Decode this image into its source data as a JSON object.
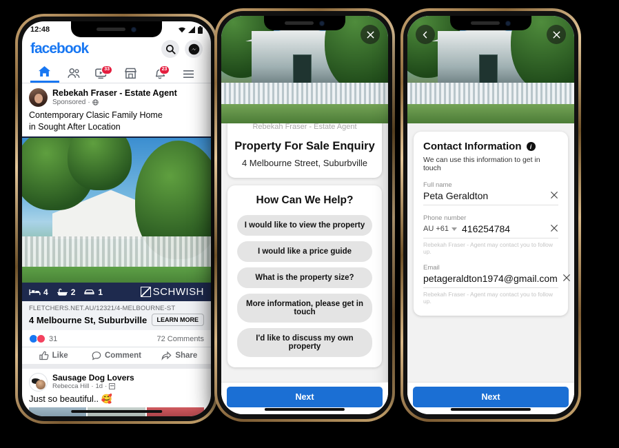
{
  "phone1": {
    "statusbar": {
      "time": "12:48",
      "wifi_icon": "wifi-icon",
      "signal_icon": "signal-icon",
      "battery_icon": "battery-icon"
    },
    "header": {
      "logo": "facebook",
      "search_icon": "search-icon",
      "messenger_icon": "messenger-icon"
    },
    "nav": [
      {
        "name": "home",
        "icon": "home-icon",
        "badge": "",
        "active": true
      },
      {
        "name": "friends",
        "icon": "friends-icon",
        "badge": "",
        "active": false
      },
      {
        "name": "watch",
        "icon": "watch-video-icon",
        "badge": "33",
        "active": false
      },
      {
        "name": "marketplace",
        "icon": "marketplace-icon",
        "badge": "",
        "active": false
      },
      {
        "name": "notifications",
        "icon": "bell-icon",
        "badge": "23",
        "active": false
      },
      {
        "name": "menu",
        "icon": "hamburger-menu-icon",
        "badge": "",
        "active": false
      }
    ],
    "post": {
      "author": "Rebekah Fraser - Estate Agent",
      "sponsored": "Sponsored",
      "globe_icon": "globe-icon",
      "body_line1": "Contemporary Clasic Family Home",
      "body_line2": "in Sought After Location",
      "features": [
        {
          "icon": "bed-icon",
          "value": "4"
        },
        {
          "icon": "bath-icon",
          "value": "2"
        },
        {
          "icon": "car-icon",
          "value": "1"
        }
      ],
      "brand": "SCHWISH",
      "link_url": "FLETCHERS.NET.AU/12321/4-MELBOURNE-ST",
      "link_title": "4 Melbourne St, Suburbville",
      "cta": "LEARN MORE",
      "reactions": "31",
      "comments": "72 Comments",
      "actions": [
        {
          "label": "Like",
          "icon": "thumbs-up-icon"
        },
        {
          "label": "Comment",
          "icon": "comment-bubble-icon"
        },
        {
          "label": "Share",
          "icon": "share-arrow-icon"
        }
      ]
    },
    "next_post": {
      "group": "Sausage Dog Lovers",
      "author": "Rebecca Hill",
      "time": "1d",
      "audience_icon": "audience-icon",
      "text": "Just so beautiful.. 🥰"
    }
  },
  "phone2": {
    "close_icon": "close-icon",
    "agent_name": "Rebekah Fraser - Estate Agent",
    "title": "Property For Sale Enquiry",
    "address": "4 Melbourne Street, Suburbville",
    "help_title": "How Can We Help?",
    "options": [
      "I would like to view the property",
      "I would like a price guide",
      "What is the property size?",
      "More information, please get in touch",
      "I'd like to discuss my own property"
    ],
    "next_label": "Next"
  },
  "phone3": {
    "back_icon": "back-chevron-icon",
    "close_icon": "close-icon",
    "title": "Contact Information",
    "info_icon": "info-icon",
    "subtitle": "We can use this information to get in touch",
    "fields": [
      {
        "label": "Full name",
        "value": "Peta Geraldton",
        "country": "",
        "hint": "",
        "clear_icon": "clear-icon"
      },
      {
        "label": "Phone number",
        "value": "416254784",
        "country": "AU +61",
        "hint": "Rebekah Fraser - Agent may contact you to follow up.",
        "clear_icon": "clear-icon"
      },
      {
        "label": "Email",
        "value": "petageraldton1974@gmail.com",
        "country": "",
        "hint": "Rebekah Fraser - Agent may contact you to follow up.",
        "clear_icon": "clear-icon"
      }
    ],
    "next_label": "Next"
  },
  "colors": {
    "fb_blue": "#1877f2",
    "next_blue": "#1b6fd4",
    "badge_red": "#e41e3f",
    "feature_navy": "#1e2a4e"
  }
}
